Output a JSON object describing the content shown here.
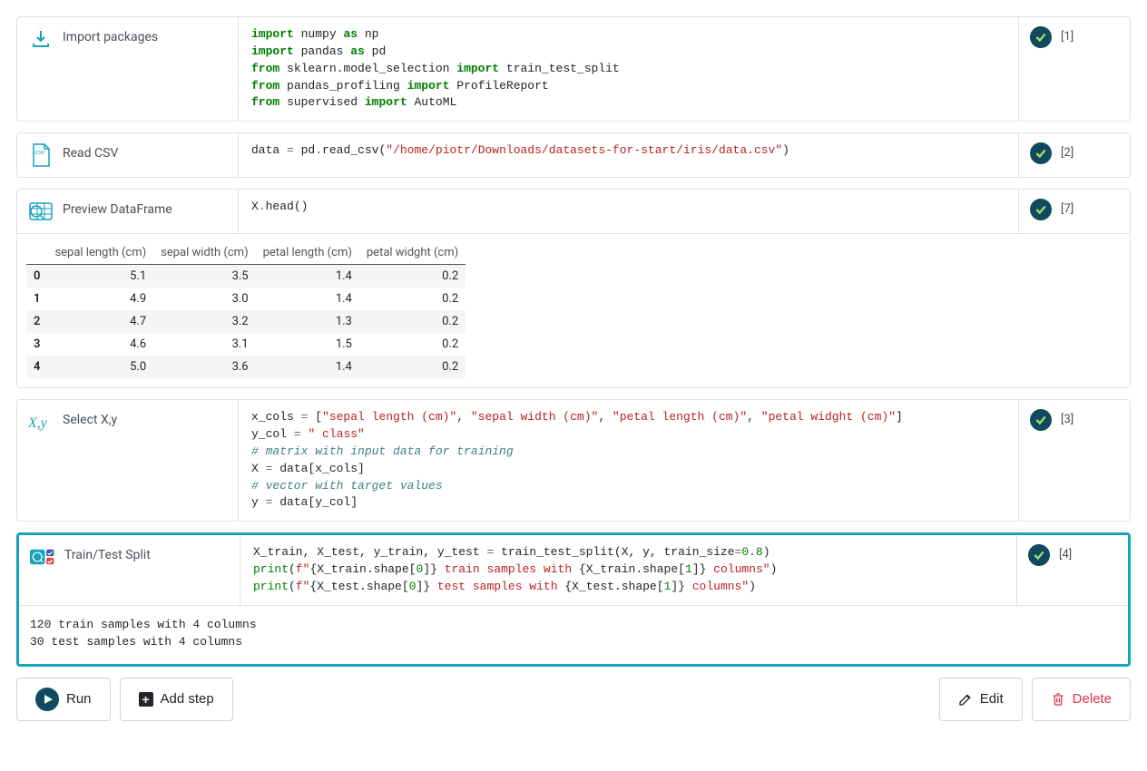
{
  "cells": [
    {
      "title": "Import packages",
      "exec": "[1]",
      "icon": "import-icon"
    },
    {
      "title": "Read CSV",
      "exec": "[2]",
      "icon": "csv-icon"
    },
    {
      "title": "Preview DataFrame",
      "exec": "[7]",
      "icon": "preview-icon"
    },
    {
      "title": "Select X,y",
      "exec": "[3]",
      "icon": "xy-icon"
    },
    {
      "title": "Train/Test Split",
      "exec": "[4]",
      "icon": "split-icon"
    }
  ],
  "code": {
    "import": {
      "l1a": "import",
      "l1b": "numpy",
      "l1c": "as",
      "l1d": "np",
      "l2a": "import",
      "l2b": "pandas",
      "l2c": "as",
      "l2d": "pd",
      "l3a": "from",
      "l3b": "sklearn.model_selection",
      "l3c": "import",
      "l3d": "train_test_split",
      "l4a": "from",
      "l4b": "pandas_profiling",
      "l4c": "import",
      "l4d": "ProfileReport",
      "l5a": "from",
      "l5b": "supervised",
      "l5c": "import",
      "l5d": "AutoML"
    },
    "readcsv": {
      "a": "data ",
      "op": "=",
      "b": " pd",
      "c": ".",
      "d": "read_csv",
      "e": "(",
      "str": "\"/home/piotr/Downloads/datasets-for-start/iris/data.csv\"",
      "f": ")"
    },
    "preview": {
      "a": "X",
      "b": ".",
      "c": "head",
      "d": "()"
    },
    "select": {
      "l1a": "x_cols ",
      "l1op": "=",
      "l1b": " [",
      "s1": "\"sepal length (cm)\"",
      "c": ", ",
      "s2": "\"sepal width (cm)\"",
      "s3": "\"petal length (cm)\"",
      "s4": "\"petal widght (cm)\"",
      "l1e": "]",
      "l2a": "y_col ",
      "l2op": "=",
      "l2b": " ",
      "l2s": "\" class\"",
      "l3": "# matrix with input data for training",
      "l4a": "X ",
      "l4op": "=",
      "l4b": " data[x_cols]",
      "l5": "# vector with target values",
      "l6a": "y ",
      "l6op": "=",
      "l6b": " data[y_col]"
    },
    "split": {
      "l1a": "X_train, X_test, y_train, y_test ",
      "l1op": "=",
      "l1b": " train_test_split(X, y, train_size",
      "l1op2": "=",
      "l1n": "0.8",
      "l1c": ")",
      "l2p": "print",
      "l2a": "(",
      "l2f": "f\"",
      "l2b": "{X_train.shape[",
      "l2n0": "0",
      "l2c": "]}",
      "l2d": " train samples with ",
      "l2e": "{X_train.shape[",
      "l2n1": "1",
      "l2g": "]}",
      "l2h": " columns\"",
      "l2i": ")",
      "l3p": "print",
      "l3a": "(",
      "l3f": "f\"",
      "l3b": "{X_test.shape[",
      "l3n0": "0",
      "l3c": "]}",
      "l3d": " test samples with ",
      "l3e": "{X_test.shape[",
      "l3n1": "1",
      "l3g": "]}",
      "l3h": " columns\"",
      "l3i": ")"
    }
  },
  "dataframe": {
    "columns": [
      "",
      "sepal length (cm)",
      "sepal width (cm)",
      "petal length (cm)",
      "petal widght (cm)"
    ],
    "rows": [
      [
        "0",
        "5.1",
        "3.5",
        "1.4",
        "0.2"
      ],
      [
        "1",
        "4.9",
        "3.0",
        "1.4",
        "0.2"
      ],
      [
        "2",
        "4.7",
        "3.2",
        "1.3",
        "0.2"
      ],
      [
        "3",
        "4.6",
        "3.1",
        "1.5",
        "0.2"
      ],
      [
        "4",
        "5.0",
        "3.6",
        "1.4",
        "0.2"
      ]
    ]
  },
  "split_output": "120 train samples with 4 columns\n30 test samples with 4 columns",
  "toolbar": {
    "run": "Run",
    "add": "Add step",
    "edit": "Edit",
    "delete": "Delete"
  }
}
